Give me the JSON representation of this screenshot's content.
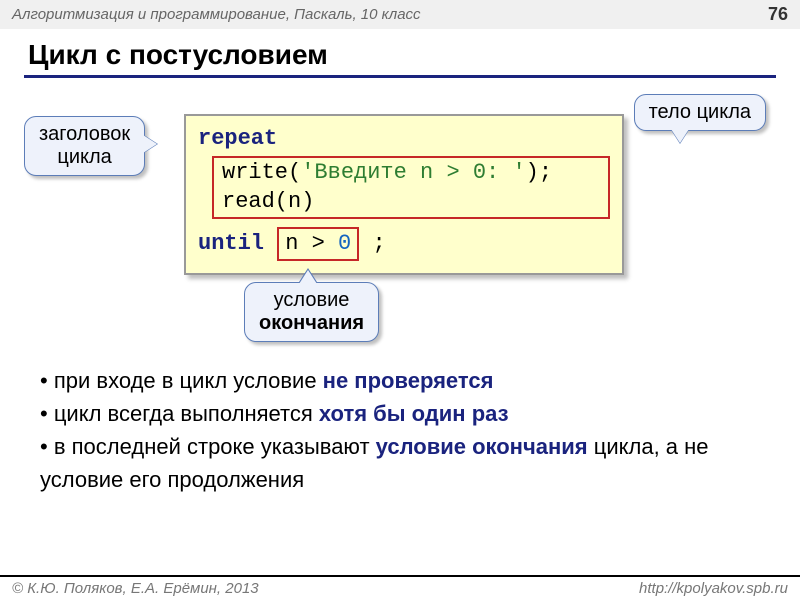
{
  "header": {
    "course": "Алгоритмизация и программирование, Паскаль, 10 класс",
    "page": "76"
  },
  "title": "Цикл с постусловием",
  "callouts": {
    "header_l1": "заголовок",
    "header_l2": "цикла",
    "body": "тело цикла",
    "cond_l1": "условие",
    "cond_l2": "окончания"
  },
  "code": {
    "repeat": "repeat",
    "write_fn": "write(",
    "write_str": "'Введите n > 0: '",
    "write_end": ");",
    "read": "read(n)",
    "until": "until",
    "cond_pre": "n > ",
    "cond_num": "0",
    "semicolon": ";"
  },
  "bullets": [
    {
      "pre": "при входе в цикл условие ",
      "em": "не проверяется",
      "post": ""
    },
    {
      "pre": "цикл всегда выполняется ",
      "em": "хотя бы один раз",
      "post": ""
    },
    {
      "pre": "в последней строке указывают ",
      "em": "условие окончания",
      "post": " цикла, а не условие его продолжения"
    }
  ],
  "footer": {
    "authors": "© К.Ю. Поляков, Е.А. Ерёмин, 2013",
    "url": "http://kpolyakov.spb.ru"
  }
}
